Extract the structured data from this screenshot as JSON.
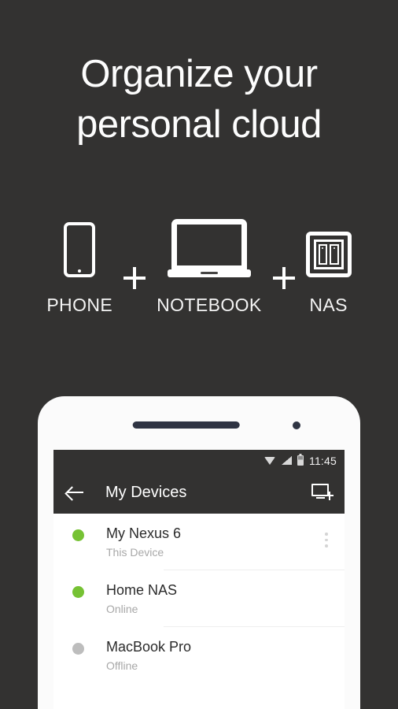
{
  "hero": {
    "headline_line1": "Organize your",
    "headline_line2": "personal cloud"
  },
  "devices_row": {
    "items": [
      {
        "icon": "phone-icon",
        "label": "PHONE"
      },
      {
        "icon": "notebook-icon",
        "label": "NOTEBOOK"
      },
      {
        "icon": "nas-icon",
        "label": "NAS"
      }
    ],
    "separator": "+"
  },
  "phone_screen": {
    "status_bar": {
      "wifi_icon": "wifi-icon",
      "signal_icon": "signal-icon",
      "battery_icon": "battery-icon",
      "clock": "11:45"
    },
    "app_bar": {
      "back_icon": "back-arrow-icon",
      "title": "My Devices",
      "action_icon": "add-device-icon"
    },
    "device_list": [
      {
        "name": "My Nexus 6",
        "status": "This Device",
        "state": "online",
        "has_overflow": true,
        "overflow_icon": "more-vertical-icon"
      },
      {
        "name": "Home NAS",
        "status": "Online",
        "state": "online",
        "has_overflow": false
      },
      {
        "name": "MacBook Pro",
        "status": "Offline",
        "state": "offline",
        "has_overflow": false
      }
    ]
  },
  "colors": {
    "background": "#333231",
    "online_green": "#76c234",
    "offline_gray": "#bdbdbd",
    "app_bar": "#333231",
    "phone_body": "#fbfbfb"
  }
}
